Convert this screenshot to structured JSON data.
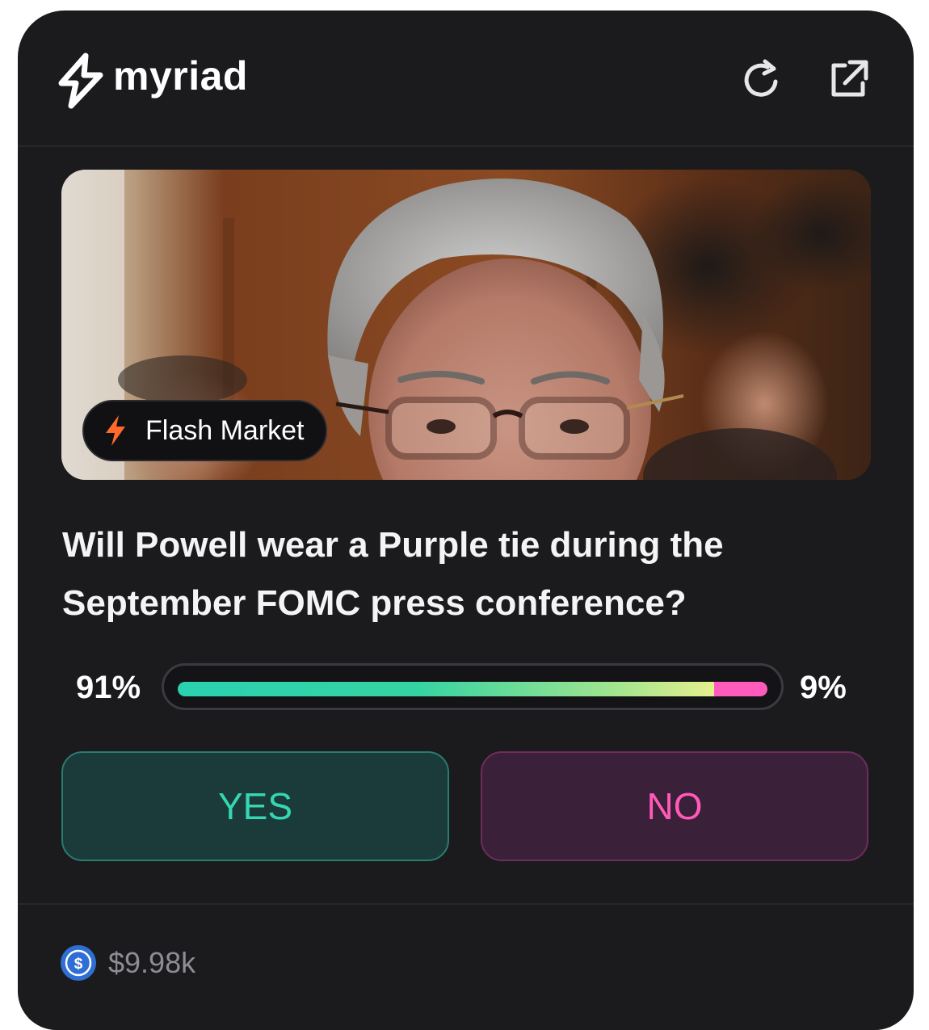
{
  "header": {
    "brand": "myriad",
    "icons": [
      "refresh-icon",
      "external-link-icon"
    ]
  },
  "market": {
    "badge_label": "Flash Market",
    "question": "Will Powell wear a Purple tie during the September FOMC press conference?",
    "yes_percent_label": "91%",
    "no_percent_label": "9%",
    "yes_share": 0.91,
    "no_share": 0.09,
    "yes_label": "YES",
    "no_label": "NO"
  },
  "footer": {
    "volume": "$9.98k",
    "currency_icon": "usdc-coin-icon"
  },
  "colors": {
    "background": "#1b1b1d",
    "yes_accent": "#36d6b2",
    "no_accent": "#ff5ab8",
    "flash_accent": "#ff6a2b"
  }
}
